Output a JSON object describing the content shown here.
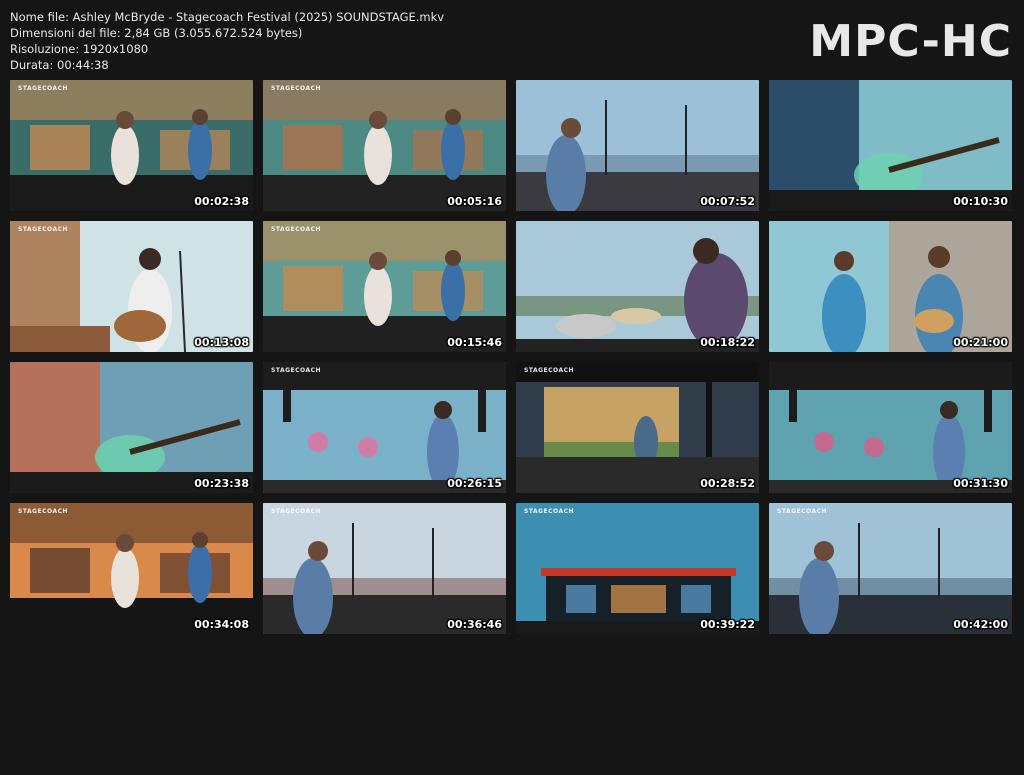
{
  "file_info": {
    "name": "Nome file: Ashley McBryde - Stagecoach Festival (2025) SOUNDSTAGE.mkv",
    "size": "Dimensioni del file: 2,84 GB (3.055.672.524 bytes)",
    "resolution": "Risoluzione: 1920x1080",
    "duration": "Durata: 00:44:38"
  },
  "logo": "MPC-HC",
  "thumbnails": [
    {
      "time": "00:02:38",
      "tag": "STAGECOACH",
      "scene": "stage-teal",
      "colors": [
        "#3a6d6a",
        "#c58a55",
        "#1a1a1a"
      ]
    },
    {
      "time": "00:05:16",
      "tag": "STAGECOACH",
      "scene": "stage-teal",
      "colors": [
        "#4d8a84",
        "#b0724a",
        "#222"
      ]
    },
    {
      "time": "00:07:52",
      "tag": "",
      "scene": "sky-crowd",
      "colors": [
        "#9cc0d8",
        "#6b8aa0",
        "#3a3a40"
      ]
    },
    {
      "time": "00:10:30",
      "tag": "",
      "scene": "guitar-close",
      "colors": [
        "#7fbcc8",
        "#2c4d6a",
        "#1a1a1a"
      ]
    },
    {
      "time": "00:13:08",
      "tag": "STAGECOACH",
      "scene": "singer-sky",
      "colors": [
        "#cfe3e6",
        "#a46a3e",
        "#2b2b2b"
      ]
    },
    {
      "time": "00:15:46",
      "tag": "STAGECOACH",
      "scene": "stage-teal",
      "colors": [
        "#5e9c97",
        "#c48a4e",
        "#202020"
      ]
    },
    {
      "time": "00:18:22",
      "tag": "",
      "scene": "drums",
      "colors": [
        "#a9c9d9",
        "#5c4a6e",
        "#222"
      ]
    },
    {
      "time": "00:21:00",
      "tag": "",
      "scene": "duo",
      "colors": [
        "#8fc7d5",
        "#c48a6a",
        "#2a2a2a"
      ]
    },
    {
      "time": "00:23:38",
      "tag": "",
      "scene": "guitar-close",
      "colors": [
        "#6e9fb5",
        "#b5705a",
        "#1b1b1b"
      ]
    },
    {
      "time": "00:26:15",
      "tag": "STAGECOACH",
      "scene": "rig",
      "colors": [
        "#7bb1c8",
        "#d17ca6",
        "#1d1d1d"
      ]
    },
    {
      "time": "00:28:52",
      "tag": "STAGECOACH",
      "scene": "big-stage",
      "colors": [
        "#2f3c4a",
        "#e0b46a",
        "#111"
      ]
    },
    {
      "time": "00:31:30",
      "tag": "",
      "scene": "rig",
      "colors": [
        "#5fa2b0",
        "#c36a8e",
        "#1b1b1b"
      ]
    },
    {
      "time": "00:34:08",
      "tag": "STAGECOACH",
      "scene": "warm-stage",
      "colors": [
        "#d98a4a",
        "#5a3a2a",
        "#151515"
      ]
    },
    {
      "time": "00:36:46",
      "tag": "STAGECOACH",
      "scene": "sky-crowd",
      "colors": [
        "#c7d6e0",
        "#8f6f6a",
        "#2a2a2a"
      ]
    },
    {
      "time": "00:39:22",
      "tag": "STAGECOACH",
      "scene": "wide-stage",
      "colors": [
        "#3c8fb0",
        "#c23a2a",
        "#152029"
      ]
    },
    {
      "time": "00:42:00",
      "tag": "STAGECOACH",
      "scene": "sky-crowd",
      "colors": [
        "#9fc2d6",
        "#5f7890",
        "#2a3038"
      ]
    }
  ]
}
